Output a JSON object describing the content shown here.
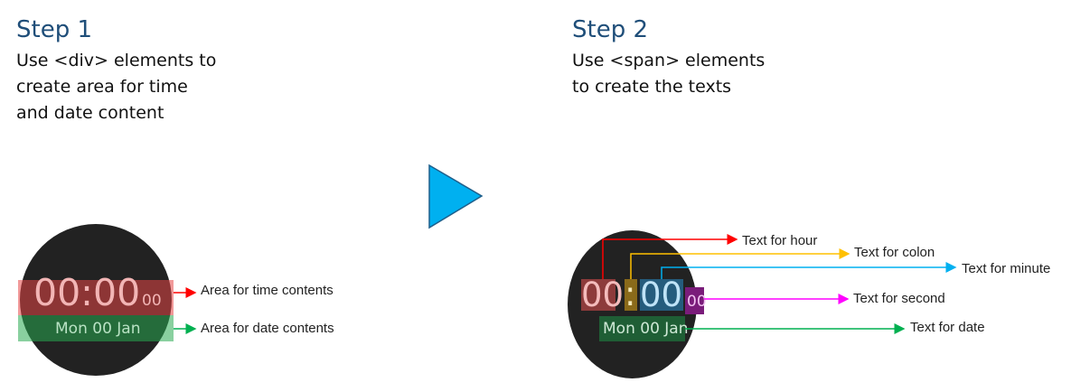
{
  "step1": {
    "title": "Step 1",
    "desc": [
      "Use <div> elements to",
      "create area for time",
      "and date content"
    ],
    "watch": {
      "time": "00:00",
      "seconds": "00",
      "date": "Mon 00 Jan"
    },
    "labels": {
      "time_area": "Area for time contents",
      "date_area": "Area for date contents"
    }
  },
  "step2": {
    "title": "Step 2",
    "desc": [
      "Use <span> elements",
      "to create the texts"
    ],
    "watch": {
      "hour": "00",
      "colon": ":",
      "minute": "00",
      "seconds": "00",
      "date": "Mon 00 Jan"
    },
    "labels": {
      "hour": "Text for hour",
      "colon": "Text for colon",
      "minute": "Text for minute",
      "second": "Text for second",
      "date": "Text for date"
    }
  },
  "colors": {
    "title": "#1f4e79",
    "play_arrow": "#00b0f0",
    "red": "#ff0000",
    "green": "#00b050",
    "yellow": "#ffc000",
    "cyan": "#00b0f0",
    "magenta": "#ff00ff",
    "watch_face": "#222222"
  },
  "icons": {
    "next_arrow": "play-triangle-icon"
  }
}
